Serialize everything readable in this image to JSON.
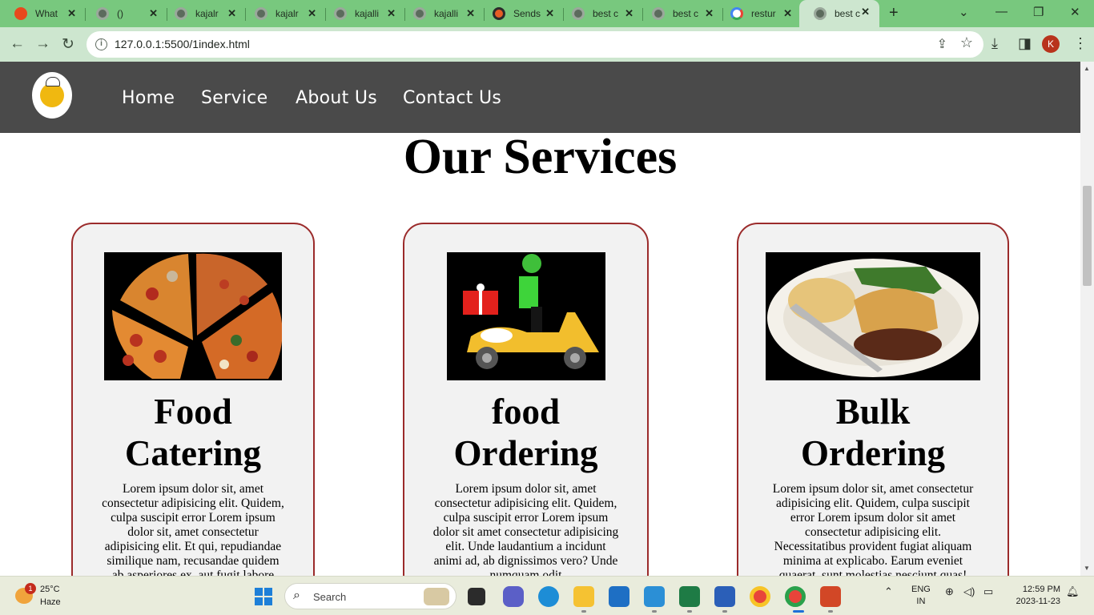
{
  "browser": {
    "tabs": [
      {
        "title": "What",
        "favicon": "alert-icon"
      },
      {
        "title": "()",
        "favicon": "globe-icon"
      },
      {
        "title": "kajalr",
        "favicon": "globe-icon"
      },
      {
        "title": "kajalr",
        "favicon": "globe-icon"
      },
      {
        "title": "kajalli",
        "favicon": "globe-icon"
      },
      {
        "title": "kajalli",
        "favicon": "globe-icon"
      },
      {
        "title": "Sends",
        "favicon": "sends-icon"
      },
      {
        "title": "best c",
        "favicon": "globe-icon"
      },
      {
        "title": "best c",
        "favicon": "globe-icon"
      },
      {
        "title": "restur",
        "favicon": "google-icon"
      },
      {
        "title": "best c",
        "favicon": "globe-icon",
        "active": true
      }
    ],
    "url": "127.0.0.1:5500/1index.html",
    "profile_initial": "K"
  },
  "site": {
    "nav": [
      "Home",
      "Service",
      "About Us",
      "Contact Us"
    ],
    "logo_text": "Kitchen"
  },
  "services": {
    "title": "Our Services",
    "cards": [
      {
        "title": "Food Catering",
        "image": "pizza-slices",
        "text": "Lorem ipsum dolor sit, amet consectetur adipisicing elit. Quidem, culpa suscipit error Lorem ipsum dolor sit, amet consectetur adipisicing elit. Et qui, repudiandae similique nam, recusandae quidem ab asperiores ex, aut fugit labore"
      },
      {
        "title": "food Ordering",
        "image": "delivery-scooter",
        "text": "Lorem ipsum dolor sit, amet consectetur adipisicing elit. Quidem, culpa suscipit error Lorem ipsum dolor sit amet consectetur adipisicing elit. Unde laudantium a incidunt animi ad, ab dignissimos vero? Unde numquam odit"
      },
      {
        "title": "Bulk Ordering",
        "image": "pie-plate",
        "text": "Lorem ipsum dolor sit, amet consectetur adipisicing elit. Quidem, culpa suscipit error Lorem ipsum dolor sit amet consectetur adipisicing elit. Necessitatibus provident fugiat aliquam minima at explicabo. Earum eveniet quaerat, sunt molestias nesciunt quas!"
      }
    ]
  },
  "taskbar": {
    "weather_temp": "25°C",
    "weather_cond": "Haze",
    "weather_badge": "1",
    "search_placeholder": "Search",
    "lang_line1": "ENG",
    "lang_line2": "IN",
    "time": "12:59 PM",
    "date": "2023-11-23"
  },
  "colors": {
    "tabstrip": "#78c87e",
    "toolbar": "#cde6cf",
    "site_nav": "#4a4a4a",
    "card_border": "#9b2b2b",
    "card_bg": "#f2f2f2"
  }
}
